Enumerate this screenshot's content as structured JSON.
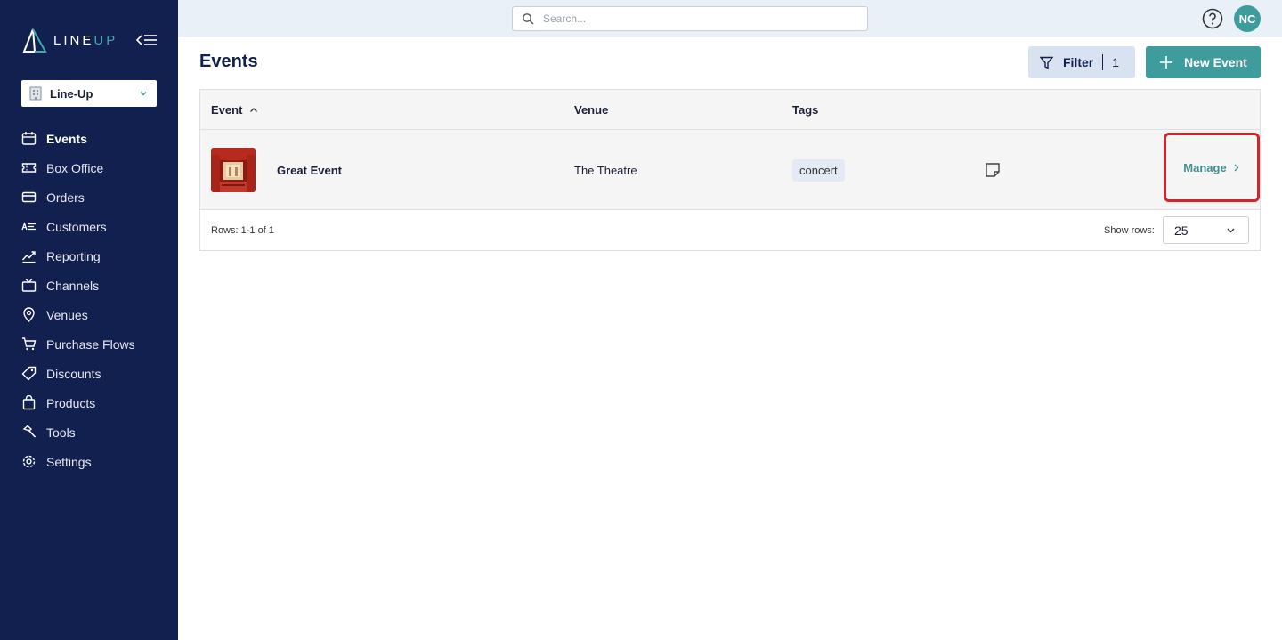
{
  "brand": {
    "logo_text_a": "LINE",
    "logo_text_b": "UP"
  },
  "org": {
    "name": "Line-Up"
  },
  "sidebar": {
    "items": [
      {
        "label": "Events",
        "icon": "calendar-icon",
        "active": true
      },
      {
        "label": "Box Office",
        "icon": "ticket-icon"
      },
      {
        "label": "Orders",
        "icon": "card-icon"
      },
      {
        "label": "Customers",
        "icon": "customers-icon"
      },
      {
        "label": "Reporting",
        "icon": "chart-line-icon"
      },
      {
        "label": "Channels",
        "icon": "tv-icon"
      },
      {
        "label": "Venues",
        "icon": "map-pin-icon"
      },
      {
        "label": "Purchase Flows",
        "icon": "cart-icon"
      },
      {
        "label": "Discounts",
        "icon": "tag-icon"
      },
      {
        "label": "Products",
        "icon": "bag-icon"
      },
      {
        "label": "Tools",
        "icon": "hammer-icon"
      },
      {
        "label": "Settings",
        "icon": "gear-icon"
      }
    ]
  },
  "topbar": {
    "search_placeholder": "Search...",
    "avatar_initials": "NC"
  },
  "page": {
    "title": "Events",
    "filter_label": "Filter",
    "filter_count": "1",
    "new_event_label": "New Event"
  },
  "table": {
    "columns": {
      "event": "Event",
      "venue": "Venue",
      "tags": "Tags"
    },
    "rows": [
      {
        "name": "Great Event",
        "venue": "The Theatre",
        "tag": "concert",
        "action": "Manage"
      }
    ],
    "footer": {
      "rows_info": "Rows: 1-1 of 1",
      "show_rows_label": "Show rows:",
      "show_rows_value": "25"
    }
  },
  "colors": {
    "sidebar": "#12204f",
    "accent": "#3f9c9c",
    "highlight": "#d3252c"
  }
}
